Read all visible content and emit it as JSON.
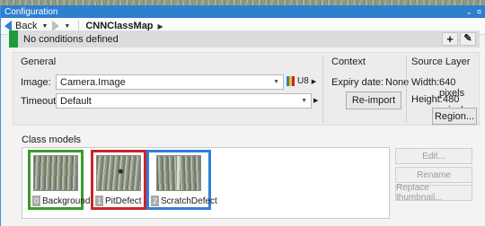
{
  "window": {
    "title": "Configuration",
    "title_controls": [
      "⌄",
      "¤"
    ]
  },
  "nav": {
    "back_label": "Back",
    "breadcrumb": "CNNClassMap"
  },
  "condition": {
    "text": "No conditions defined",
    "add_label": "+",
    "edit_label": "✎"
  },
  "general": {
    "title": "General",
    "image_label": "Image:",
    "image_value": "Camera.Image",
    "image_type": "U8",
    "timeout_label": "Timeout:",
    "timeout_value": "Default"
  },
  "context": {
    "title": "Context",
    "expiry_label": "Expiry date:",
    "expiry_value": "None",
    "reimport_button": "Re-import"
  },
  "source_layer": {
    "title": "Source Layer",
    "width_label": "Width:",
    "width_value": "640 pixels",
    "height_label": "Height:",
    "height_value": "480 pixels",
    "region_button": "Region..."
  },
  "class_models": {
    "title": "Class models",
    "items": [
      {
        "index": "0",
        "name": "Background",
        "color": "#3a9a2a"
      },
      {
        "index": "1",
        "name": "PitDefect",
        "color": "#c8262b"
      },
      {
        "index": "2",
        "name": "ScratchDefect",
        "color": "#2f7fd8"
      }
    ],
    "edit_button": "Edit...",
    "rename_button": "Rename",
    "replace_button": "Replace thumbnail..."
  },
  "colors": {
    "titlebar": "#2f7fcf",
    "condition_marker": "#1e9b3b"
  }
}
